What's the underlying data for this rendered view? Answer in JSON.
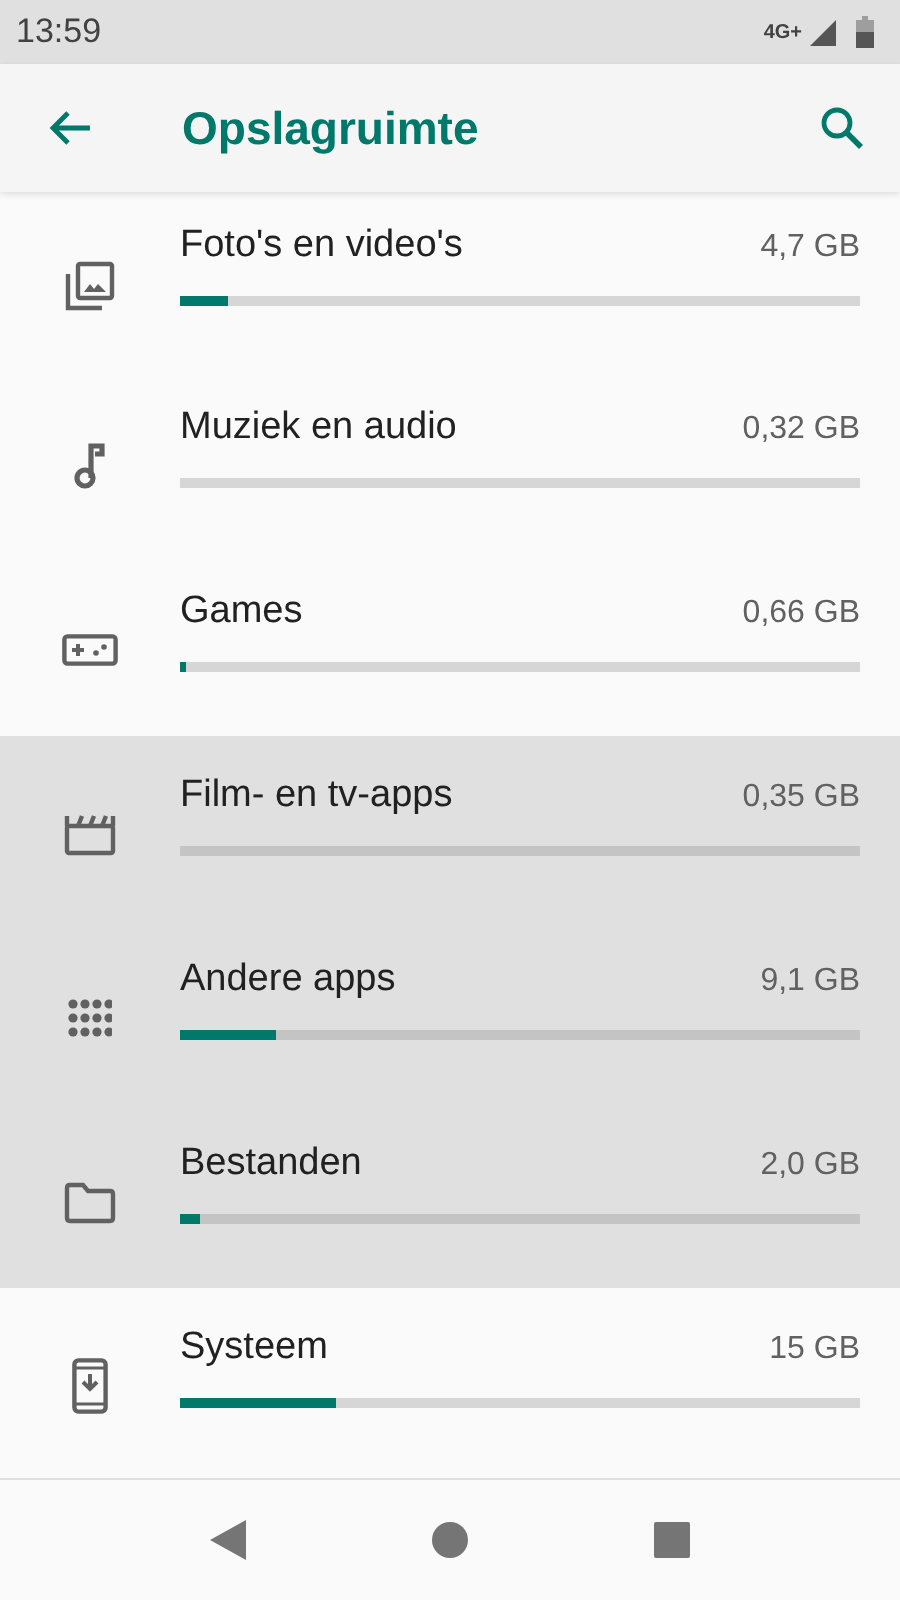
{
  "status_bar": {
    "time": "13:59",
    "network": "4G+"
  },
  "toolbar": {
    "title": "Opslagruimte"
  },
  "items": [
    {
      "kind": "photos",
      "label": "Foto's en video's",
      "size": "4,7 GB",
      "level": 0.07,
      "selected": false
    },
    {
      "kind": "music",
      "label": "Muziek en audio",
      "size": "0,32 GB",
      "selected": false
    },
    {
      "kind": "games",
      "label": "Games",
      "size": "0,66 GB",
      "level": 0.01,
      "selected": false
    },
    {
      "kind": "movies",
      "label": "Film- en tv-apps",
      "size": "0,35 GB",
      "selected": true
    },
    {
      "kind": "apps",
      "label": "Andere apps",
      "size": "9,1 GB",
      "level": 0.14,
      "selected": true
    },
    {
      "kind": "files",
      "label": "Bestanden",
      "size": "2,0 GB",
      "level": 0.03,
      "selected": true
    },
    {
      "kind": "system",
      "label": "Systeem",
      "size": "15 GB",
      "level": 0.23,
      "selected": false
    }
  ]
}
